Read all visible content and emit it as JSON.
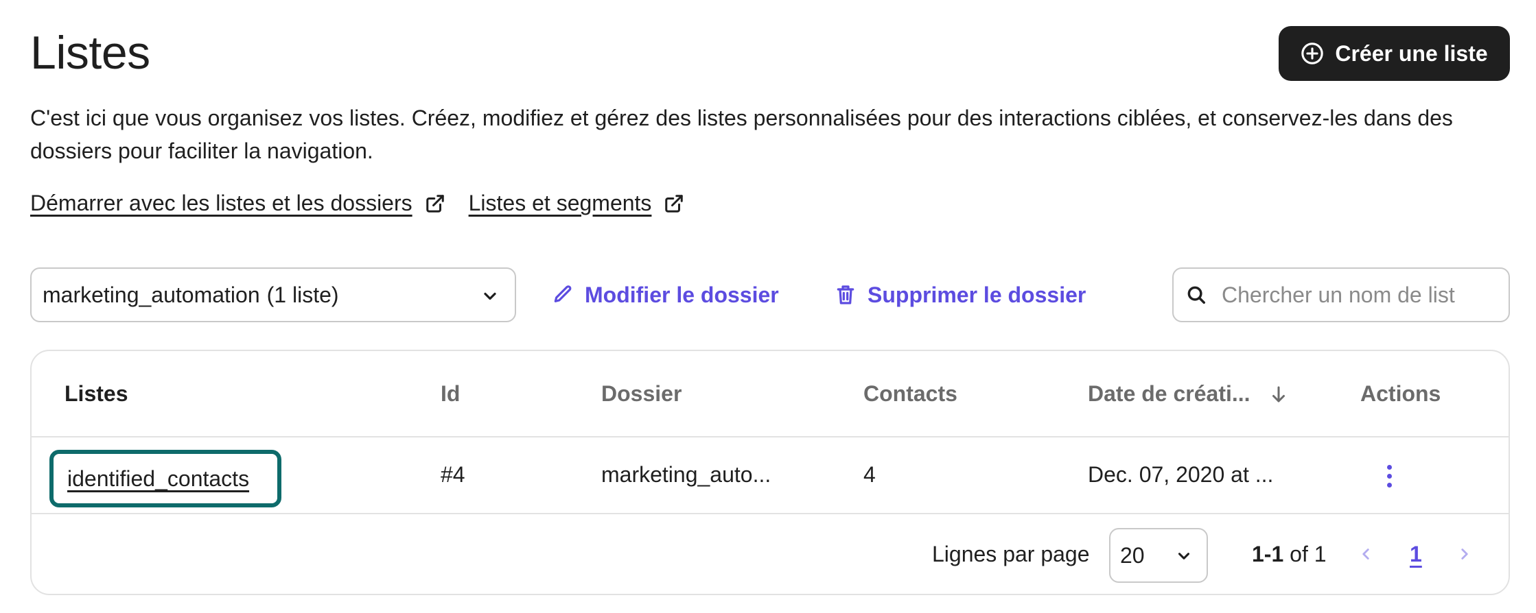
{
  "header": {
    "title": "Listes",
    "create_button_label": "Créer une liste"
  },
  "description": "C'est ici que vous organisez vos listes. Créez, modifiez et gérez des listes personnalisées pour des interactions ciblées, et conservez-les dans des dossiers pour faciliter la navigation.",
  "help_links": [
    {
      "label": "Démarrer avec les listes et les dossiers"
    },
    {
      "label": "Listes et segments"
    }
  ],
  "toolbar": {
    "folder_name": "marketing_automation",
    "folder_count": "(1 liste)",
    "edit_folder_label": "Modifier le dossier",
    "delete_folder_label": "Supprimer le dossier",
    "search_placeholder": "Chercher un nom de list"
  },
  "table": {
    "columns": [
      "Listes",
      "Id",
      "Dossier",
      "Contacts",
      "Date de créati...",
      "Actions"
    ],
    "rows": [
      {
        "name": "identified_contacts",
        "id": "#4",
        "folder": "marketing_auto...",
        "contacts": "4",
        "created": "Dec. 07, 2020 at ..."
      }
    ]
  },
  "pagination": {
    "rows_per_page_label": "Lignes par page",
    "rows_per_page_value": "20",
    "range_bold": "1-1",
    "range_rest": " of 1",
    "current_page": "1"
  },
  "colors": {
    "primary_button": "#1f1f1f",
    "accent": "#5c4ce0",
    "focus_ring": "#0e6b6b",
    "border": "#e2e2e2"
  }
}
